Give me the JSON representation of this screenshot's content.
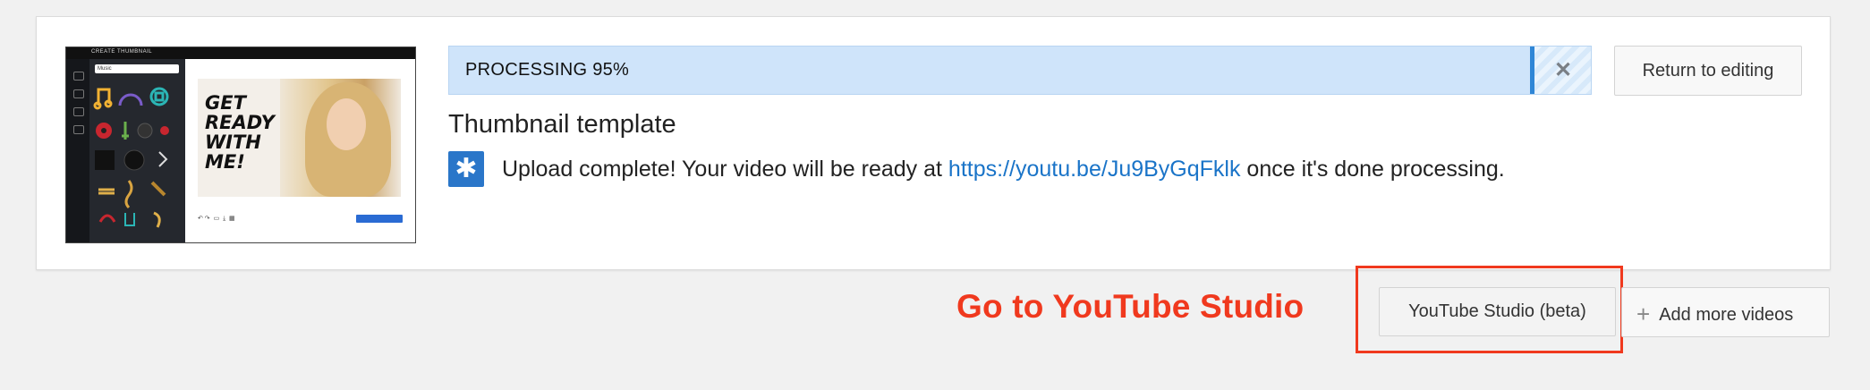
{
  "upload_card": {
    "thumbnail": {
      "description_icon": "video-thumbnail",
      "editor_title": "CREATE THUMBNAIL",
      "search_text": "Music",
      "art_text": "GET\nREADY\nWITH\nME!",
      "publish_label": "Publish"
    },
    "progress": {
      "label": "PROCESSING 95%",
      "percent": 95,
      "close_icon": "close-icon"
    },
    "return_button": "Return to editing",
    "video_title": "Thumbnail template",
    "status": {
      "icon": "star-icon",
      "prefix": "Upload complete! Your video will be ready at ",
      "link": "https://youtu.be/Ju9ByGqFklk",
      "suffix": " once it's done processing."
    }
  },
  "annotation": {
    "callout_text": "Go to YouTube Studio",
    "color": "#f0391e"
  },
  "footer": {
    "studio_button": "YouTube Studio (beta)",
    "add_more_button": "Add more videos"
  },
  "colors": {
    "progress_fill": "#cfe4fa",
    "progress_edge": "#2f86d6",
    "link": "#1a74c8",
    "page_bg": "#f1f1f1"
  }
}
